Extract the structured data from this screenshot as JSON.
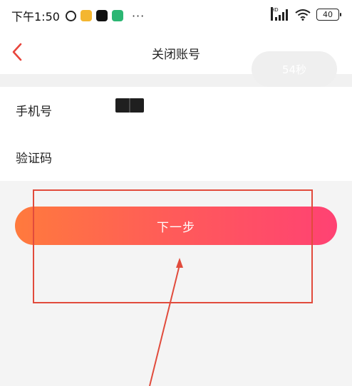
{
  "status_bar": {
    "time": "下午1:50",
    "notification_icons": [
      "alarm-icon",
      "app-notify-icon",
      "capcut-icon",
      "shield-app-icon"
    ],
    "overflow": "···",
    "network_label": "HD",
    "battery": "40"
  },
  "nav": {
    "back_icon": "chevron-left-icon",
    "title": "关闭账号"
  },
  "form": {
    "phone_label": "手机号",
    "code_label": "验证码",
    "code_value": "",
    "countdown_label": "54秒"
  },
  "next_button": {
    "label": "下一步"
  },
  "colors": {
    "accent_start": "#ff7a3d",
    "accent_end": "#ff4273",
    "back_arrow": "#e8453c",
    "annotation": "#e14b3c"
  }
}
